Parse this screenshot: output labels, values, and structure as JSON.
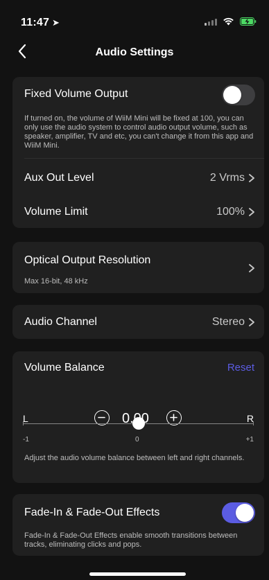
{
  "status": {
    "time": "11:47"
  },
  "nav": {
    "title": "Audio Settings"
  },
  "output": {
    "fixed_volume": {
      "label": "Fixed Volume Output",
      "enabled": false,
      "description": "If turned on, the volume of WiiM Mini will be fixed at 100, you can only use the audio system to control audio output volume, such as speaker, amplifier, TV and etc, you can't change it from this app and WiiM Mini."
    },
    "aux_out_level": {
      "label": "Aux Out Level",
      "value": "2 Vrms"
    },
    "volume_limit": {
      "label": "Volume Limit",
      "value": "100%"
    }
  },
  "optical": {
    "label": "Optical Output Resolution",
    "subtitle": "Max 16-bit, 48 kHz"
  },
  "channel": {
    "label": "Audio Channel",
    "value": "Stereo"
  },
  "balance": {
    "label": "Volume Balance",
    "reset": "Reset",
    "left": "L",
    "right": "R",
    "value": "0.00",
    "min_label": "-1",
    "mid_label": "0",
    "max_label": "+1",
    "level": 0.5,
    "description": "Adjust the audio volume balance between left and right channels."
  },
  "fade": {
    "label": "Fade-In & Fade-Out Effects",
    "enabled": true,
    "description": "Fade-In & Fade-Out Effects enable smooth transitions between tracks, eliminating clicks and pops."
  },
  "colors": {
    "accent": "#5b5ce2",
    "card": "#202020",
    "background": "#121212"
  }
}
